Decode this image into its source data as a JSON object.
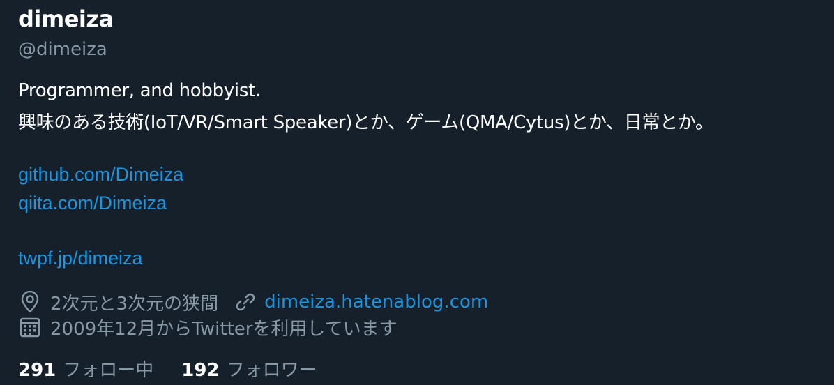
{
  "profile": {
    "display_name": "dimeiza",
    "handle": "@dimeiza",
    "bio_lines": [
      "Programmer, and hobbyist.",
      "興味のある技術(IoT/VR/Smart Speaker)とか、ゲーム(QMA/Cytus)とか、日常とか。"
    ],
    "bio_links": [
      "github.com/Dimeiza",
      "qiita.com/Dimeiza",
      "twpf.jp/dimeiza"
    ],
    "location": "2次元と3次元の狭間",
    "website": "dimeiza.hatenablog.com",
    "joined": "2009年12月からTwitterを利用しています",
    "following_count": "291",
    "following_label": "フォロー中",
    "followers_count": "192",
    "followers_label": "フォロワー"
  },
  "icons": {
    "location": "location-pin-icon",
    "website": "link-icon",
    "joined": "calendar-icon"
  },
  "colors": {
    "background": "#15202b",
    "primary_text": "#ffffff",
    "secondary_text": "#8899a6",
    "link": "#1b95e0"
  }
}
